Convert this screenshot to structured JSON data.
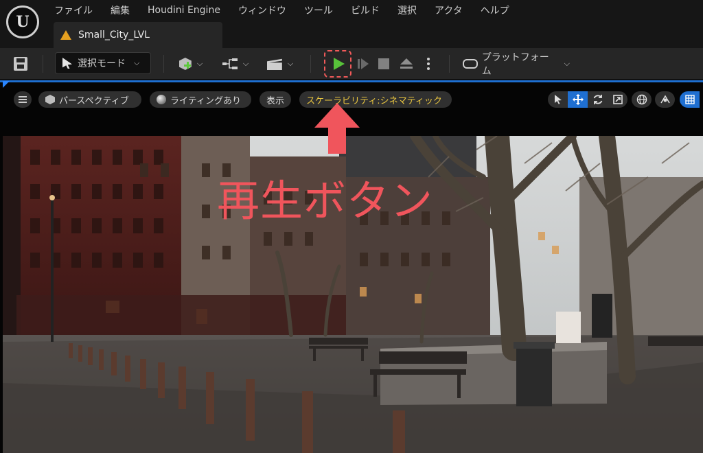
{
  "app": {
    "logo_letter": "U"
  },
  "menu": [
    "ファイル",
    "編集",
    "Houdini Engine",
    "ウィンドウ",
    "ツール",
    "ビルド",
    "選択",
    "アクタ",
    "ヘルプ"
  ],
  "level_tab": {
    "name": "Small_City_LVL"
  },
  "toolbar": {
    "mode_select_label": "選択モード",
    "platform_label": "プラットフォーム",
    "icons": [
      "save-icon",
      "select-mode-icon",
      "add-actor-icon",
      "blueprint-icon",
      "cinematics-icon",
      "play-icon",
      "skip-icon",
      "stop-icon",
      "eject-icon",
      "more-options-icon",
      "gamepad-icon"
    ]
  },
  "viewport": {
    "perspective_label": "パースペクティブ",
    "lighting_label": "ライティングあり",
    "show_label": "表示",
    "scalability_label": "スケーラビリティ:シネマティック",
    "tools": [
      "select-icon",
      "move-icon",
      "rotate-icon",
      "scale-icon",
      "globe-icon",
      "surface-snap-icon",
      "grid-icon"
    ]
  },
  "annotation": {
    "label": "再生ボタン"
  },
  "colors": {
    "accent_blue": "#1f6fd1",
    "play_green": "#58c23a",
    "annotation_red": "#f0555c",
    "scalability_yellow": "#e7c440",
    "level_orange": "#e5a020"
  }
}
